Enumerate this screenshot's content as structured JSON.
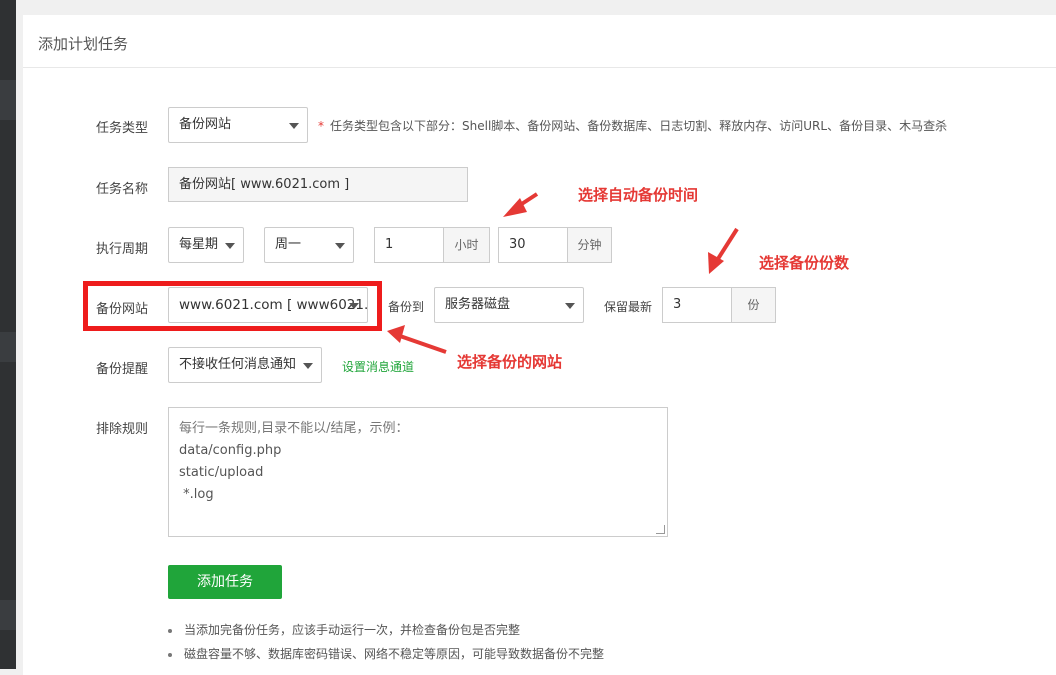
{
  "panel_title": "添加计划任务",
  "form": {
    "task_type": {
      "label": "任务类型",
      "value": "备份网站",
      "hint": "任务类型包含以下部分：Shell脚本、备份网站、备份数据库、日志切割、释放内存、访问URL、备份目录、木马查杀"
    },
    "task_name": {
      "label": "任务名称",
      "value": "备份网站[ www.6021.com ]"
    },
    "cycle": {
      "label": "执行周期",
      "period": "每星期",
      "weekday": "周一",
      "hour": "1",
      "hour_unit": "小时",
      "minute": "30",
      "minute_unit": "分钟"
    },
    "backup_site": {
      "label": "备份网站",
      "value": "www.6021.com [ www6021...",
      "backup_to_label": "备份到",
      "backup_to_value": "服务器磁盘",
      "keep_label": "保留最新",
      "keep_value": "3",
      "keep_unit": "份"
    },
    "notify": {
      "label": "备份提醒",
      "value": "不接收任何消息通知",
      "link": "设置消息通道"
    },
    "exclude": {
      "label": "排除规则",
      "lines": [
        "每行一条规则,目录不能以/结尾，示例：",
        "data/config.php",
        "static/upload",
        " *.log"
      ]
    },
    "submit_label": "添加任务"
  },
  "notes": [
    "当添加完备份任务，应该手动运行一次，并检查备份包是否完整",
    "磁盘容量不够、数据库密码错误、网络不稳定等原因，可能导致数据备份不完整"
  ],
  "annotations": {
    "time": "选择自动备份时间",
    "count": "选择备份份数",
    "site": "选择备份的网站"
  },
  "colors": {
    "accent_green": "#20a53a",
    "annotation_red": "#e53935",
    "highlight_box": "#ee1c1c"
  }
}
